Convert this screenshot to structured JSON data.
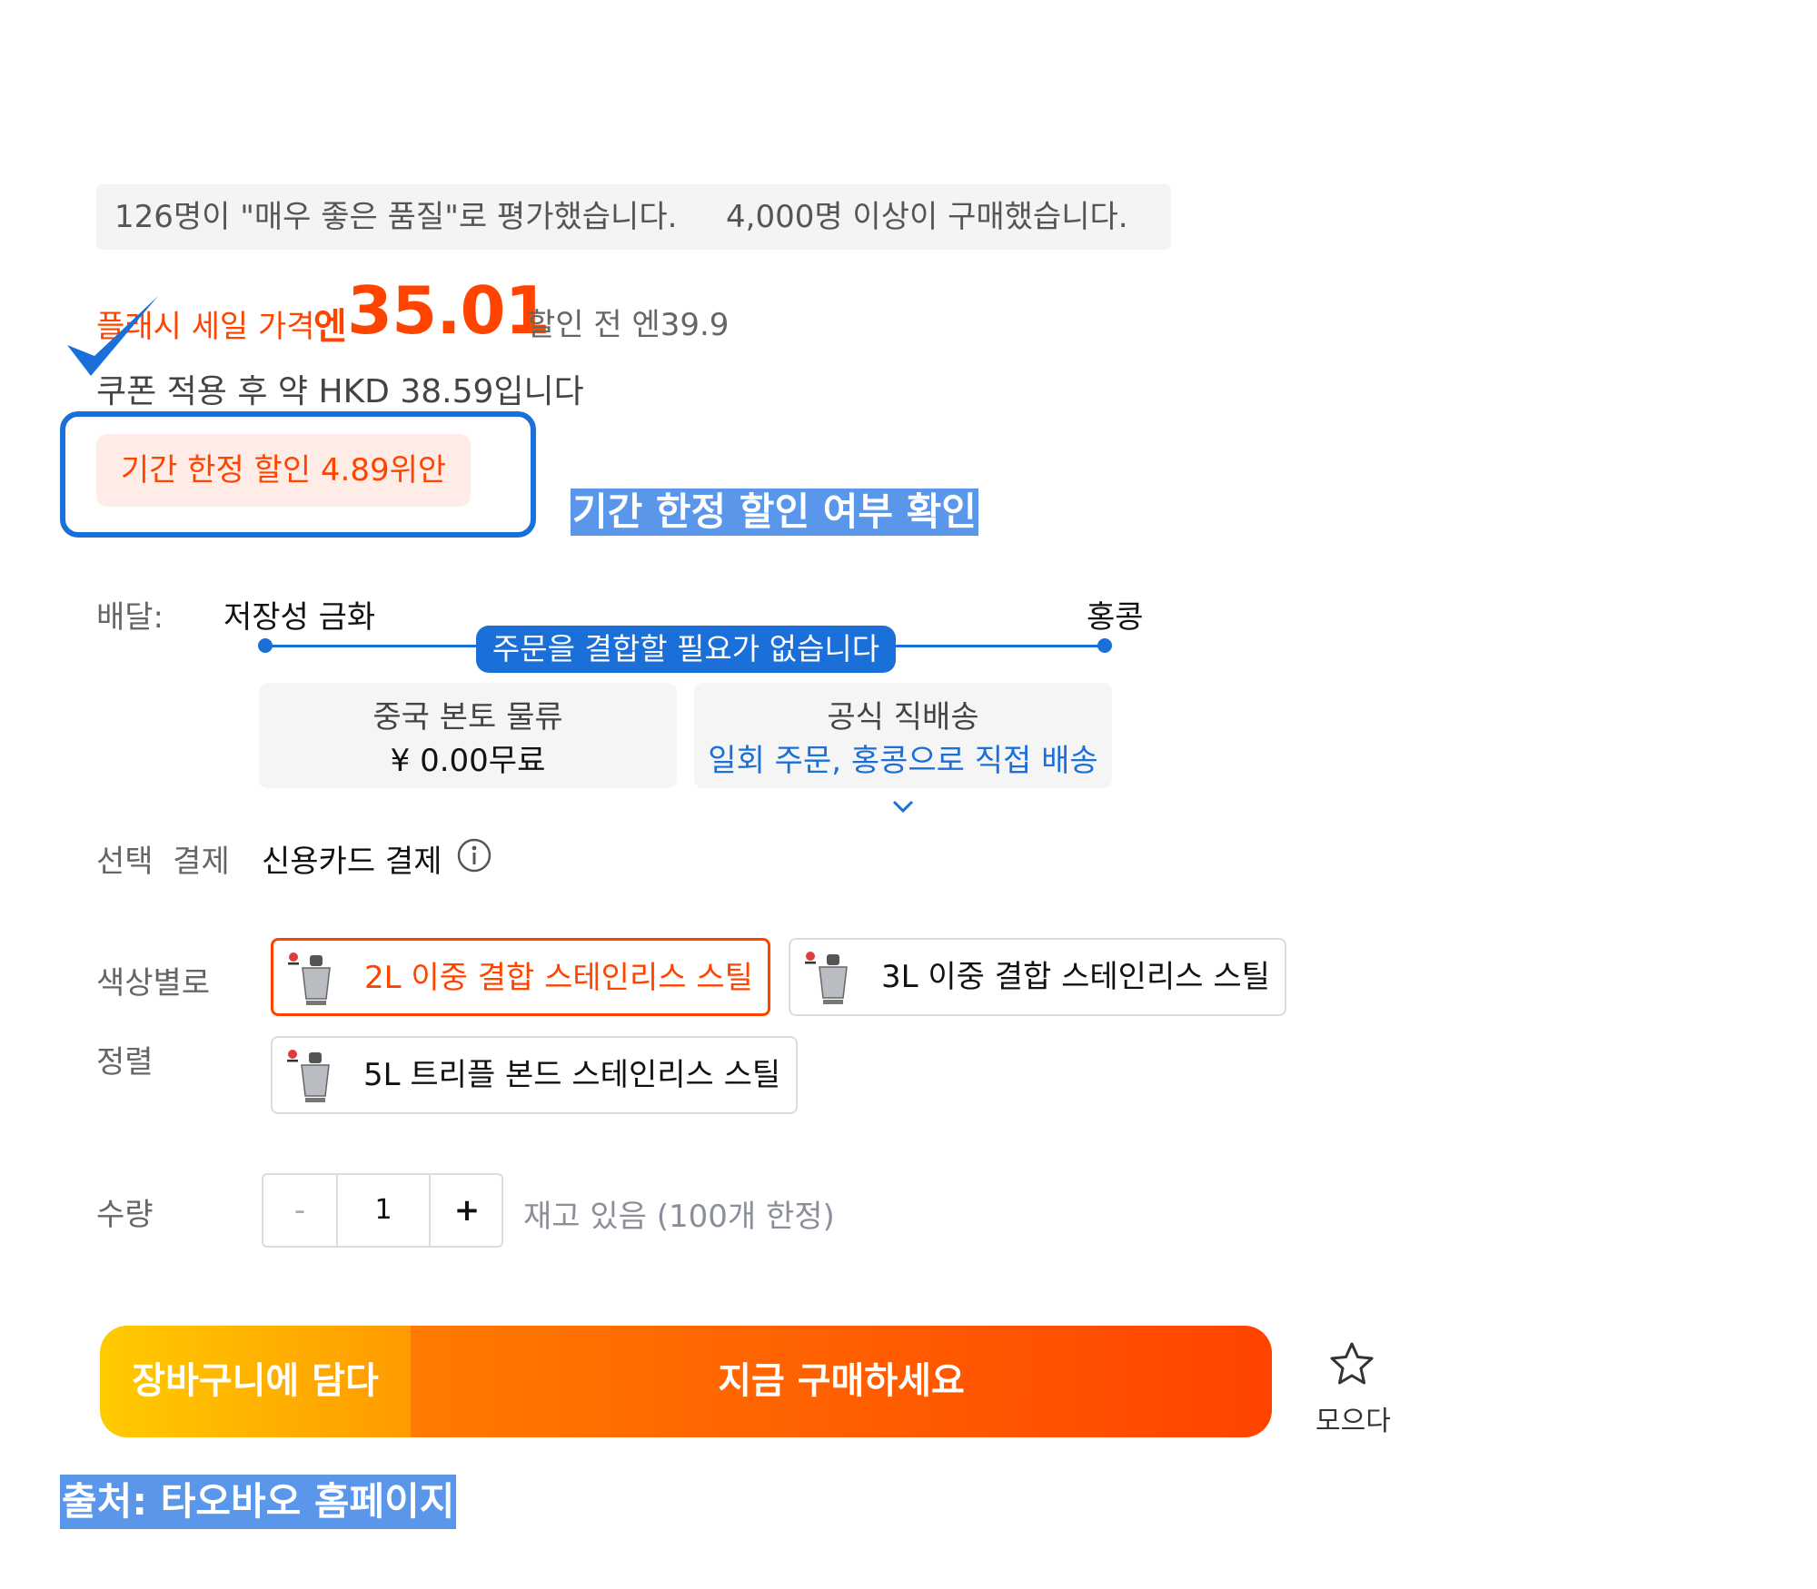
{
  "social_proof": {
    "quality_tag": "126명이 \"매우 좋은 품질\"로 평가했습니다.",
    "purchase_tag": "4,000명 이상이 구매했습니다."
  },
  "price": {
    "flash_label": "플래시 세일 가격",
    "currency": "엔",
    "value": "35.01",
    "original": "할인 전 엔39.9",
    "coupon_text": "쿠폰 적용 후 약 HKD 38.59입니다"
  },
  "limited_discount": {
    "badge": "기간 한정 할인 4.89위안",
    "annotation": "기간 한정 할인 여부 확인"
  },
  "delivery": {
    "label": "배달:",
    "from": "저장성 금화",
    "to": "홍콩",
    "route_badge": "주문을 결합할 필요가 없습니다",
    "mainland": {
      "title": "중국 본토 물류",
      "price": "¥ 0.00무료"
    },
    "direct": {
      "title": "공식 직배송",
      "link": "일회 주문, 홍콩으로 직접 배송"
    }
  },
  "payment": {
    "label": "선택  결제",
    "value": "신용카드 결제"
  },
  "options": {
    "label_color": "색상별로",
    "label_sort": "정렬",
    "items": [
      {
        "label": "2L 이중 결합 스테인리스 스틸",
        "selected": true
      },
      {
        "label": "3L 이중 결합 스테인리스 스틸",
        "selected": false
      },
      {
        "label": "5L 트리플 본드 스테인리스 스틸",
        "selected": false
      }
    ]
  },
  "quantity": {
    "label": "수량",
    "minus": "-",
    "value": "1",
    "plus": "+",
    "stock": "재고 있음 (100개 한정)"
  },
  "actions": {
    "cart": "장바구니에 담다",
    "buy": "지금 구매하세요",
    "collect": "모으다"
  },
  "source": "출처: 타오바오 홈페이지",
  "colors": {
    "accent_orange": "#ff4400",
    "accent_blue": "#1b6fd8",
    "annotation_blue": "#5a97ea"
  }
}
